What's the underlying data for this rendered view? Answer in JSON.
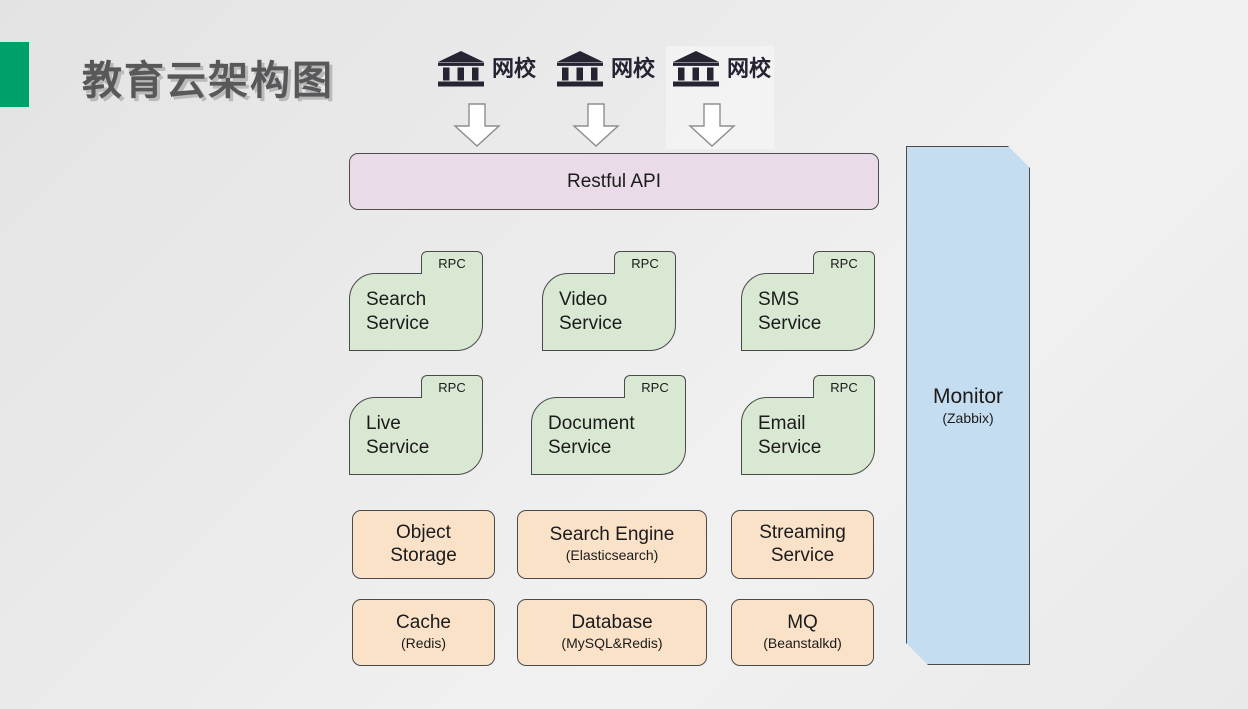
{
  "title": "教育云架构图",
  "accent_color": "#00a06b",
  "background": "#eaeaea",
  "clients": [
    {
      "label": "网校",
      "icon": "bank-icon",
      "arrow": "down-arrow-icon"
    },
    {
      "label": "网校",
      "icon": "bank-icon",
      "arrow": "down-arrow-icon"
    },
    {
      "label": "网校",
      "icon": "bank-icon",
      "arrow": "down-arrow-icon"
    }
  ],
  "api_bar": {
    "label": "Restful API",
    "color": "#e9dce8"
  },
  "services": {
    "tab_label": "RPC",
    "color": "#d9e8d2",
    "items": [
      {
        "line1": "Search",
        "line2": "Service"
      },
      {
        "line1": "Video",
        "line2": "Service"
      },
      {
        "line1": "SMS",
        "line2": "Service"
      },
      {
        "line1": "Live",
        "line2": "Service"
      },
      {
        "line1": "Document",
        "line2": "Service"
      },
      {
        "line1": "Email",
        "line2": "Service"
      }
    ]
  },
  "infrastructure": {
    "color": "#fae2c9",
    "items": [
      {
        "main": "Object",
        "sub": "Storage",
        "sub_is_detail": false
      },
      {
        "main": "Search Engine",
        "sub": "(Elasticsearch)",
        "sub_is_detail": true
      },
      {
        "main": "Streaming",
        "sub": "Service",
        "sub_is_detail": false
      },
      {
        "main": "Cache",
        "sub": "(Redis)",
        "sub_is_detail": true
      },
      {
        "main": "Database",
        "sub": "(MySQL&Redis)",
        "sub_is_detail": true
      },
      {
        "main": "MQ",
        "sub": "(Beanstalkd)",
        "sub_is_detail": true
      }
    ]
  },
  "monitor": {
    "main": "Monitor",
    "sub": "(Zabbix)",
    "color": "#c5ddf0"
  }
}
